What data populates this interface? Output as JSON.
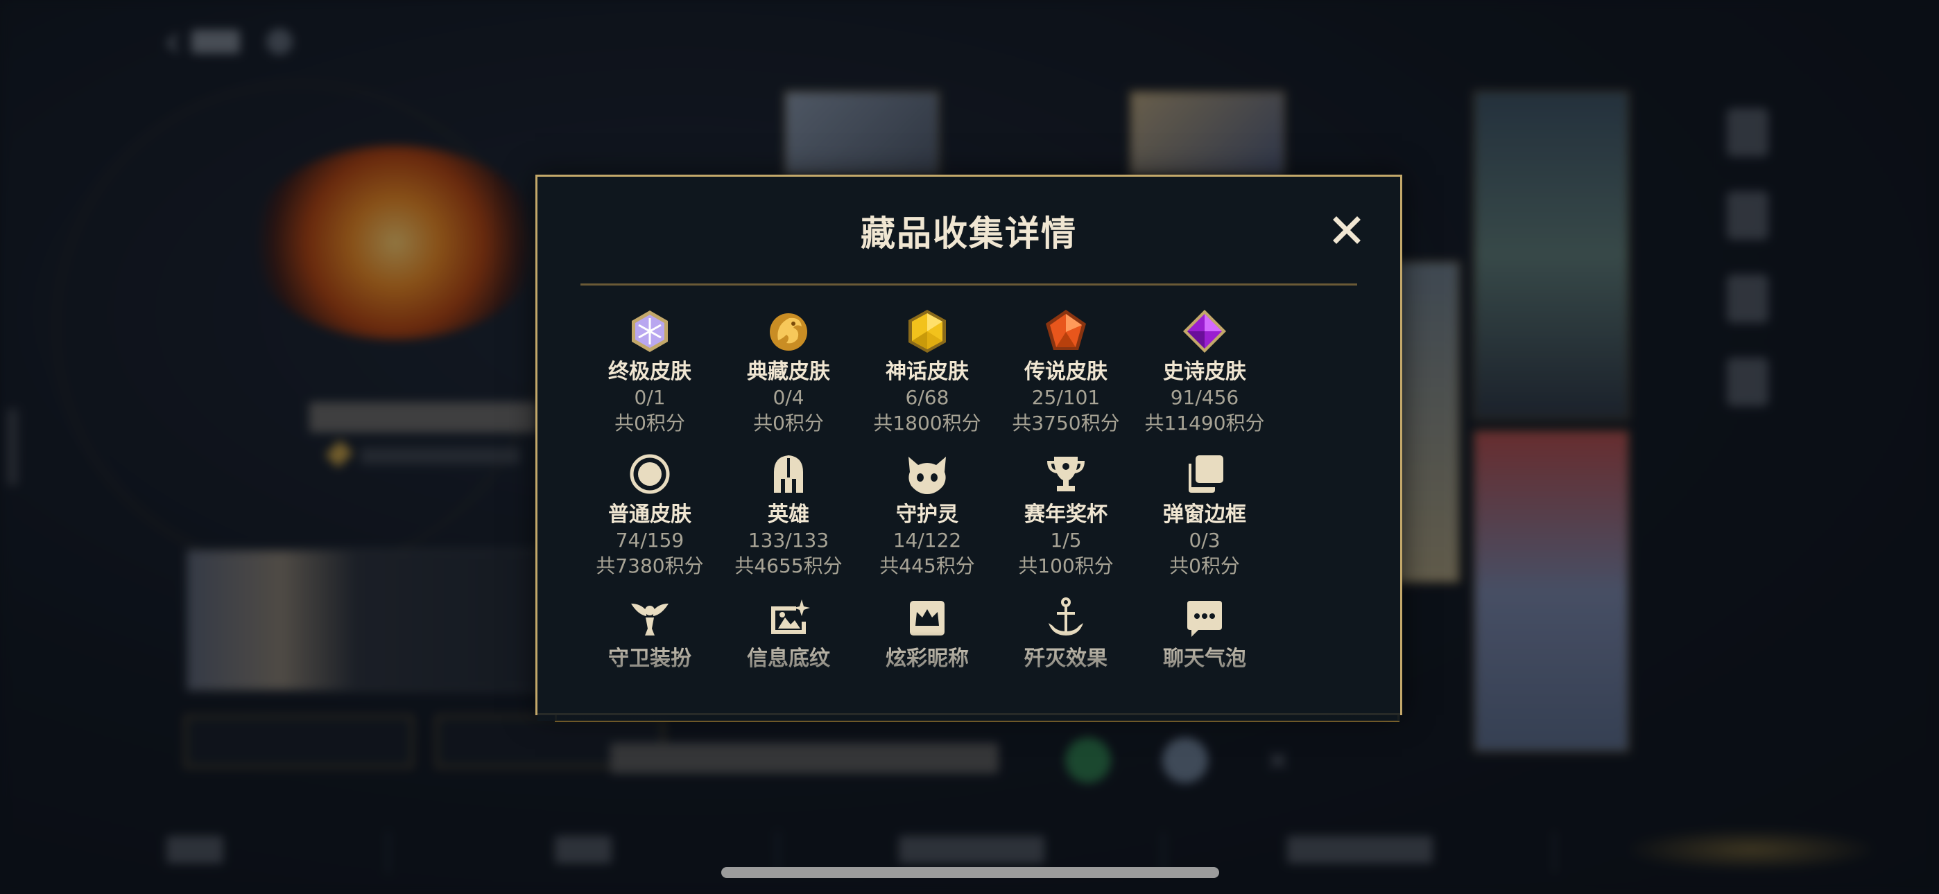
{
  "modal": {
    "title": "藏品收集详情",
    "items": [
      {
        "name": "终极皮肤",
        "count": "0/1",
        "points": "共0积分",
        "icon": "ultimate-gem-icon"
      },
      {
        "name": "典藏皮肤",
        "count": "0/4",
        "points": "共0积分",
        "icon": "prestige-dragon-icon"
      },
      {
        "name": "神话皮肤",
        "count": "6/68",
        "points": "共1800积分",
        "icon": "mythic-gem-icon"
      },
      {
        "name": "传说皮肤",
        "count": "25/101",
        "points": "共3750积分",
        "icon": "legendary-gem-icon"
      },
      {
        "name": "史诗皮肤",
        "count": "91/456",
        "points": "共11490积分",
        "icon": "epic-gem-icon"
      },
      {
        "name": "普通皮肤",
        "count": "74/159",
        "points": "共7380积分",
        "icon": "common-circle-icon"
      },
      {
        "name": "英雄",
        "count": "133/133",
        "points": "共4655积分",
        "icon": "champion-helmet-icon"
      },
      {
        "name": "守护灵",
        "count": "14/122",
        "points": "共445积分",
        "icon": "little-legend-icon"
      },
      {
        "name": "赛年奖杯",
        "count": "1/5",
        "points": "共100积分",
        "icon": "trophy-icon"
      },
      {
        "name": "弹窗边框",
        "count": "0/3",
        "points": "共0积分",
        "icon": "frame-stack-icon"
      },
      {
        "name": "守卫装扮",
        "count": "",
        "points": "",
        "icon": "ward-skin-icon"
      },
      {
        "name": "信息底纹",
        "count": "",
        "points": "",
        "icon": "banner-image-icon"
      },
      {
        "name": "炫彩昵称",
        "count": "",
        "points": "",
        "icon": "crown-nameplate-icon"
      },
      {
        "name": "歼灭效果",
        "count": "",
        "points": "",
        "icon": "anchor-effect-icon"
      },
      {
        "name": "聊天气泡",
        "count": "",
        "points": "",
        "icon": "chat-bubble-icon"
      }
    ]
  },
  "colors": {
    "gold_border": "#c3a86a",
    "modal_bg": "#0f171e",
    "text_primary": "#f0e6d2",
    "text_secondary": "#a8a496"
  }
}
